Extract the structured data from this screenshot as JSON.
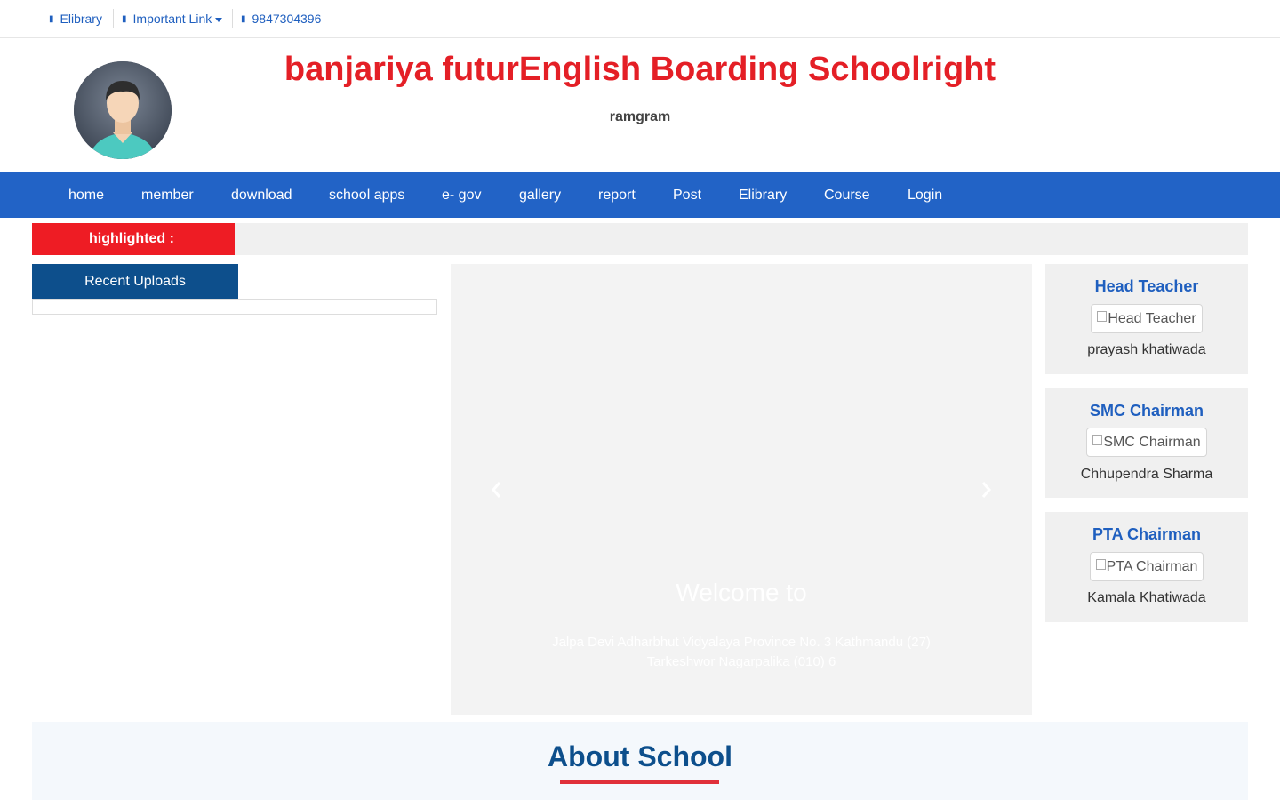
{
  "topbar": {
    "elibrary": "Elibrary",
    "important_link": "Important Link",
    "phone": "9847304396",
    "elibrary_icon": "book-icon",
    "link_icon": "link-icon",
    "phone_icon": "phone-icon"
  },
  "header": {
    "title": "banjariya futurEnglish Boarding Schoolright",
    "subtitle": "ramgram",
    "logo_icon": "avatar-icon"
  },
  "nav": {
    "items": [
      "home",
      "member",
      "download",
      "school apps",
      "e- gov",
      "gallery",
      "report",
      "Post",
      "Elibrary",
      "Course",
      "Login"
    ]
  },
  "highlight": {
    "label": "highlighted :"
  },
  "recent": {
    "heading": "Recent Uploads"
  },
  "carousel": {
    "title": "Welcome to",
    "text": "Jalpa Devi Adharbhut Vidyalaya Province No. 3 Kathmandu (27) Tarkeshwor Nagarpalika (010) 6",
    "prev_icon": "chevron-left-icon",
    "next_icon": "chevron-right-icon"
  },
  "staff": [
    {
      "title": "Head Teacher",
      "img_alt": "Head Teacher",
      "name": "prayash khatiwada"
    },
    {
      "title": "SMC Chairman",
      "img_alt": "SMC Chairman",
      "name": "Chhupendra Sharma"
    },
    {
      "title": "PTA Chairman",
      "img_alt": "PTA Chairman",
      "name": "Kamala Khatiwada"
    }
  ],
  "about": {
    "title": "About School"
  },
  "colors": {
    "brand_red": "#e41f26",
    "nav_blue": "#2263c6",
    "dark_blue": "#0d4f8c",
    "link_blue": "#1f5fbf"
  }
}
